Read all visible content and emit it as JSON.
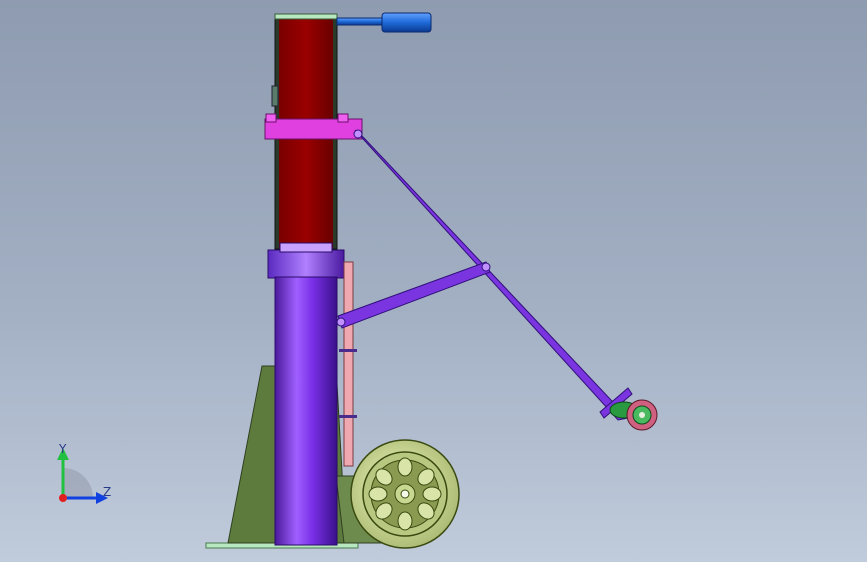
{
  "viewport": {
    "axis_labels": {
      "y": "Y",
      "z": "Z"
    }
  },
  "colors": {
    "background_top": "#8e9bb0",
    "column": "#8a3cff",
    "upper_ram": "#960000",
    "clamp": "#e040e0",
    "linkage": "#7a34e0",
    "handle": "#1e6ad8",
    "base_gusset": "#5e7b3e",
    "wheel": "#c8d890",
    "axis_y": "#22c040",
    "axis_z": "#1040e0",
    "axis_x": "#e02020"
  },
  "icons": {
    "orientation_triad": "axis-triad-icon"
  }
}
